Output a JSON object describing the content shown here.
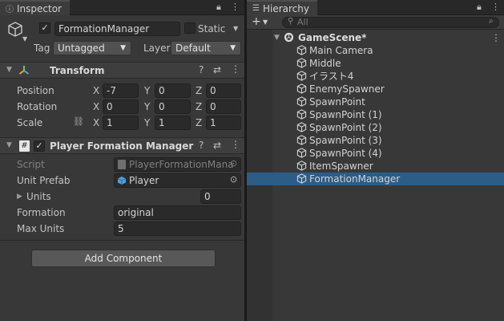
{
  "inspector": {
    "tab_label": "Inspector",
    "object_name": "FormationManager",
    "static_label": "Static",
    "tag_label": "Tag",
    "tag_value": "Untagged",
    "layer_label": "Layer",
    "layer_value": "Default",
    "transform": {
      "title": "Transform",
      "rows": [
        {
          "label": "Position",
          "x": "-7",
          "y": "0",
          "z": "0"
        },
        {
          "label": "Rotation",
          "x": "0",
          "y": "0",
          "z": "0"
        },
        {
          "label": "Scale",
          "x": "1",
          "y": "1",
          "z": "1"
        }
      ],
      "axis_x": "X",
      "axis_y": "Y",
      "axis_z": "Z"
    },
    "component": {
      "title": "Player Formation Manager (Scr",
      "script_label": "Script",
      "script_value": "PlayerFormationMana",
      "unit_prefab_label": "Unit Prefab",
      "unit_prefab_value": "Player",
      "units_label": "Units",
      "units_value": "0",
      "formation_label": "Formation",
      "formation_value": "original",
      "max_units_label": "Max Units",
      "max_units_value": "5"
    },
    "add_component_label": "Add Component"
  },
  "hierarchy": {
    "tab_label": "Hierarchy",
    "search_placeholder": "All",
    "scene_name": "GameScene*",
    "items": [
      "Main Camera",
      "Middle",
      "イラスト4",
      "EnemySpawner",
      "SpawnPoint",
      "SpawnPoint (1)",
      "SpawnPoint (2)",
      "SpawnPoint (3)",
      "SpawnPoint (4)",
      "ItemSpawner",
      "FormationManager"
    ],
    "selected_index": 10
  },
  "colors": {
    "panel_bg": "#383838",
    "selection": "#2c5d87",
    "transform_icon": "#e9a14a"
  }
}
